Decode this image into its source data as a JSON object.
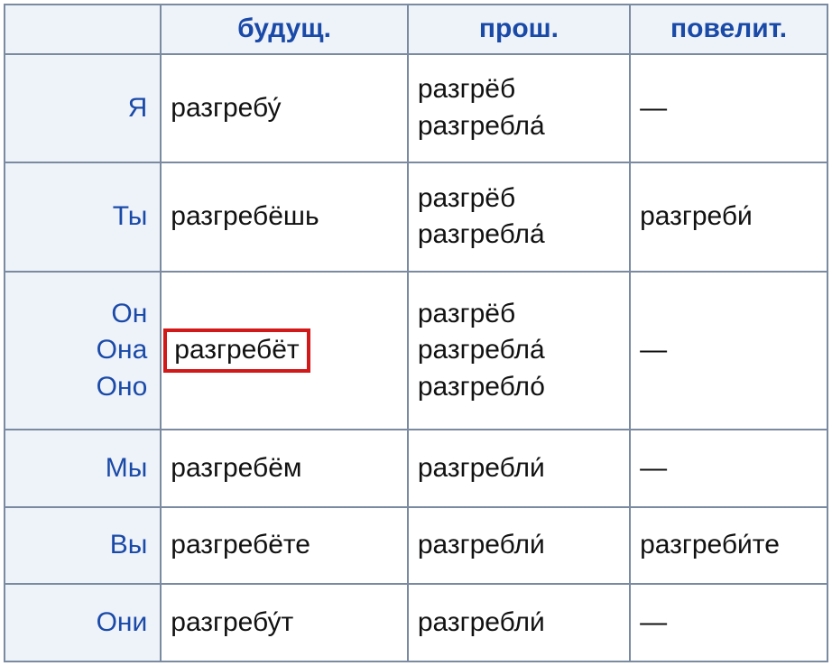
{
  "headers": {
    "col0": "",
    "col1": "будущ.",
    "col2": "прош.",
    "col3": "повелит."
  },
  "rows": {
    "r1": {
      "pronoun": "Я",
      "future": "разгребу́",
      "past1": "разгрёб",
      "past2": "разгребла́",
      "imperative": "—"
    },
    "r2": {
      "pronoun": "Ты",
      "future": "разгребёшь",
      "past1": "разгрёб",
      "past2": "разгребла́",
      "imperative": "разгреби́"
    },
    "r3": {
      "pronoun1": "Он",
      "pronoun2": "Она",
      "pronoun3": "Оно",
      "future": "разгребёт",
      "past1": "разгрёб",
      "past2": "разгребла́",
      "past3": "разгребло́",
      "imperative": "—"
    },
    "r4": {
      "pronoun": "Мы",
      "future": "разгребём",
      "past": "разгребли́",
      "imperative": "—"
    },
    "r5": {
      "pronoun": "Вы",
      "future": "разгребёте",
      "past": "разгребли́",
      "imperative": "разгреби́те"
    },
    "r6": {
      "pronoun": "Они",
      "future": "разгребу́т",
      "past": "разгребли́",
      "imperative": "—"
    }
  }
}
